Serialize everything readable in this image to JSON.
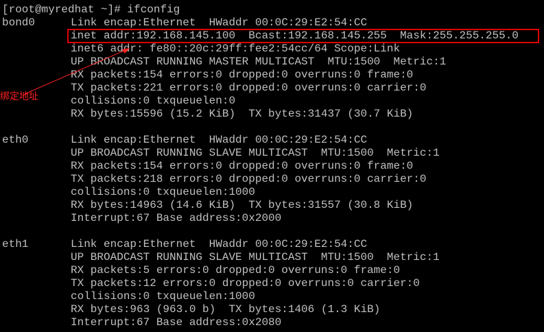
{
  "terminal": {
    "prompt": "[root@myredhat ~]# ifconfig",
    "interfaces": [
      {
        "name": "bond0",
        "lines": [
          "Link encap:Ethernet  HWaddr 00:0C:29:E2:54:CC",
          "inet addr:192.168.145.100  Bcast:192.168.145.255  Mask:255.255.255.0",
          "inet6 addr: fe80::20c:29ff:fee2:54cc/64 Scope:Link",
          "UP BROADCAST RUNNING MASTER MULTICAST  MTU:1500  Metric:1",
          "RX packets:154 errors:0 dropped:0 overruns:0 frame:0",
          "TX packets:221 errors:0 dropped:0 overruns:0 carrier:0",
          "collisions:0 txqueuelen:0",
          "RX bytes:15596 (15.2 KiB)  TX bytes:31437 (30.7 KiB)"
        ]
      },
      {
        "name": "eth0",
        "lines": [
          "Link encap:Ethernet  HWaddr 00:0C:29:E2:54:CC",
          "UP BROADCAST RUNNING SLAVE MULTICAST  MTU:1500  Metric:1",
          "RX packets:154 errors:0 dropped:0 overruns:0 frame:0",
          "TX packets:218 errors:0 dropped:0 overruns:0 carrier:0",
          "collisions:0 txqueuelen:1000",
          "RX bytes:14963 (14.6 KiB)  TX bytes:31557 (30.8 KiB)",
          "Interrupt:67 Base address:0x2000"
        ]
      },
      {
        "name": "eth1",
        "lines": [
          "Link encap:Ethernet  HWaddr 00:0C:29:E2:54:CC",
          "UP BROADCAST RUNNING SLAVE MULTICAST  MTU:1500  Metric:1",
          "RX packets:5 errors:0 dropped:0 overruns:0 frame:0",
          "TX packets:12 errors:0 dropped:0 overruns:0 carrier:0",
          "collisions:0 txqueuelen:1000",
          "RX bytes:963 (963.0 b)  TX bytes:1406 (1.3 KiB)",
          "Interrupt:67 Base address:0x2080"
        ]
      }
    ]
  },
  "annotation": {
    "label": "绑定地址",
    "color": "#ff2020"
  },
  "colors": {
    "background": "#000000",
    "text": "#c0c0c0",
    "highlight_border": "#e00000"
  }
}
